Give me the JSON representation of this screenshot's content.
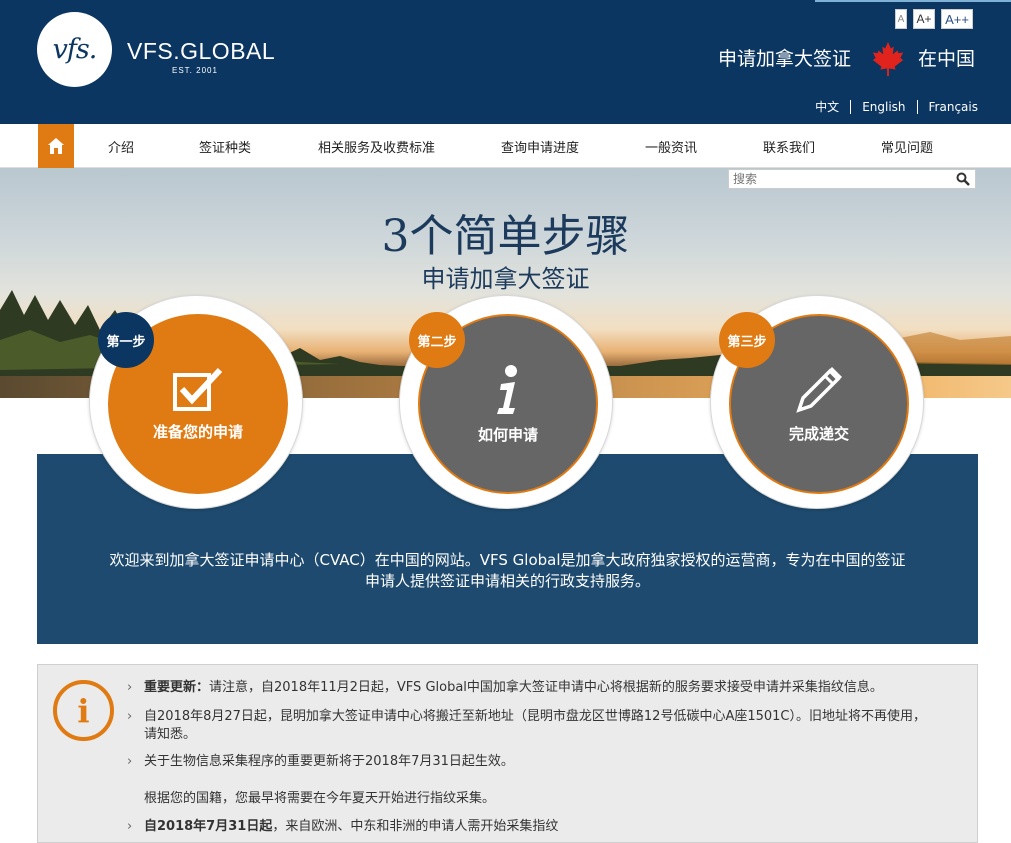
{
  "header": {
    "logo_text": "vfs.",
    "brand": "VFS.GLOBAL",
    "brand_sub": "EST. 2001",
    "font_sizes": [
      "A",
      "A+",
      "A++"
    ],
    "apply_title": "申请加拿大签证",
    "country": "在中国",
    "languages": [
      "中文",
      "English",
      "Français"
    ]
  },
  "nav": {
    "home_icon": "home-icon",
    "items": [
      "介绍",
      "签证种类",
      "相关服务及收费标准",
      "查询申请进度",
      "一般资讯",
      "联系我们",
      "常见问题"
    ]
  },
  "search": {
    "placeholder": "搜索",
    "icon": "search-icon"
  },
  "hero": {
    "title": "3个简单步骤",
    "subtitle": "申请加拿大签证"
  },
  "steps": [
    {
      "badge": "第一步",
      "label": "准备您的申请",
      "icon": "checkbox-icon"
    },
    {
      "badge": "第二步",
      "label": "如何申请",
      "icon": "info-i-icon"
    },
    {
      "badge": "第三步",
      "label": "完成递交",
      "icon": "pencil-icon"
    }
  ],
  "welcome_line1": "欢迎来到加拿大签证申请中心（CVAC）在中国的网站。VFS Global是加拿大政府独家授权的运营商，专为在中国的签证",
  "welcome_line2": "申请人提供签证申请相关的行政支持服务。",
  "notices": {
    "n1_bold": "重要更新：",
    "n1_text": "请注意，自2018年11月2日起，VFS Global中国加拿大签证申请中心将根据新的服务要求接受申请并采集指纹信息。",
    "n2_text": "自2018年8月27日起，昆明加拿大签证申请中心将搬迁至新地址（昆明市盘龙区世博路12号低碳中心A座1501C）。旧地址将不再使用，请知悉。",
    "n3_text": "关于生物信息采集程序的重要更新将于2018年7月31日起生效。",
    "n3_sub": "根据您的国籍，您最早将需要在今年夏天开始进行指纹采集。",
    "n4_bold": "自2018年7月31日起",
    "n4_text": "，来自欧洲、中东和非洲的申请人需开始采集指纹"
  },
  "colors": {
    "navy": "#0b3661",
    "orange": "#e07a12",
    "panel_blue": "#1d4a6e",
    "gray": "#666666"
  }
}
